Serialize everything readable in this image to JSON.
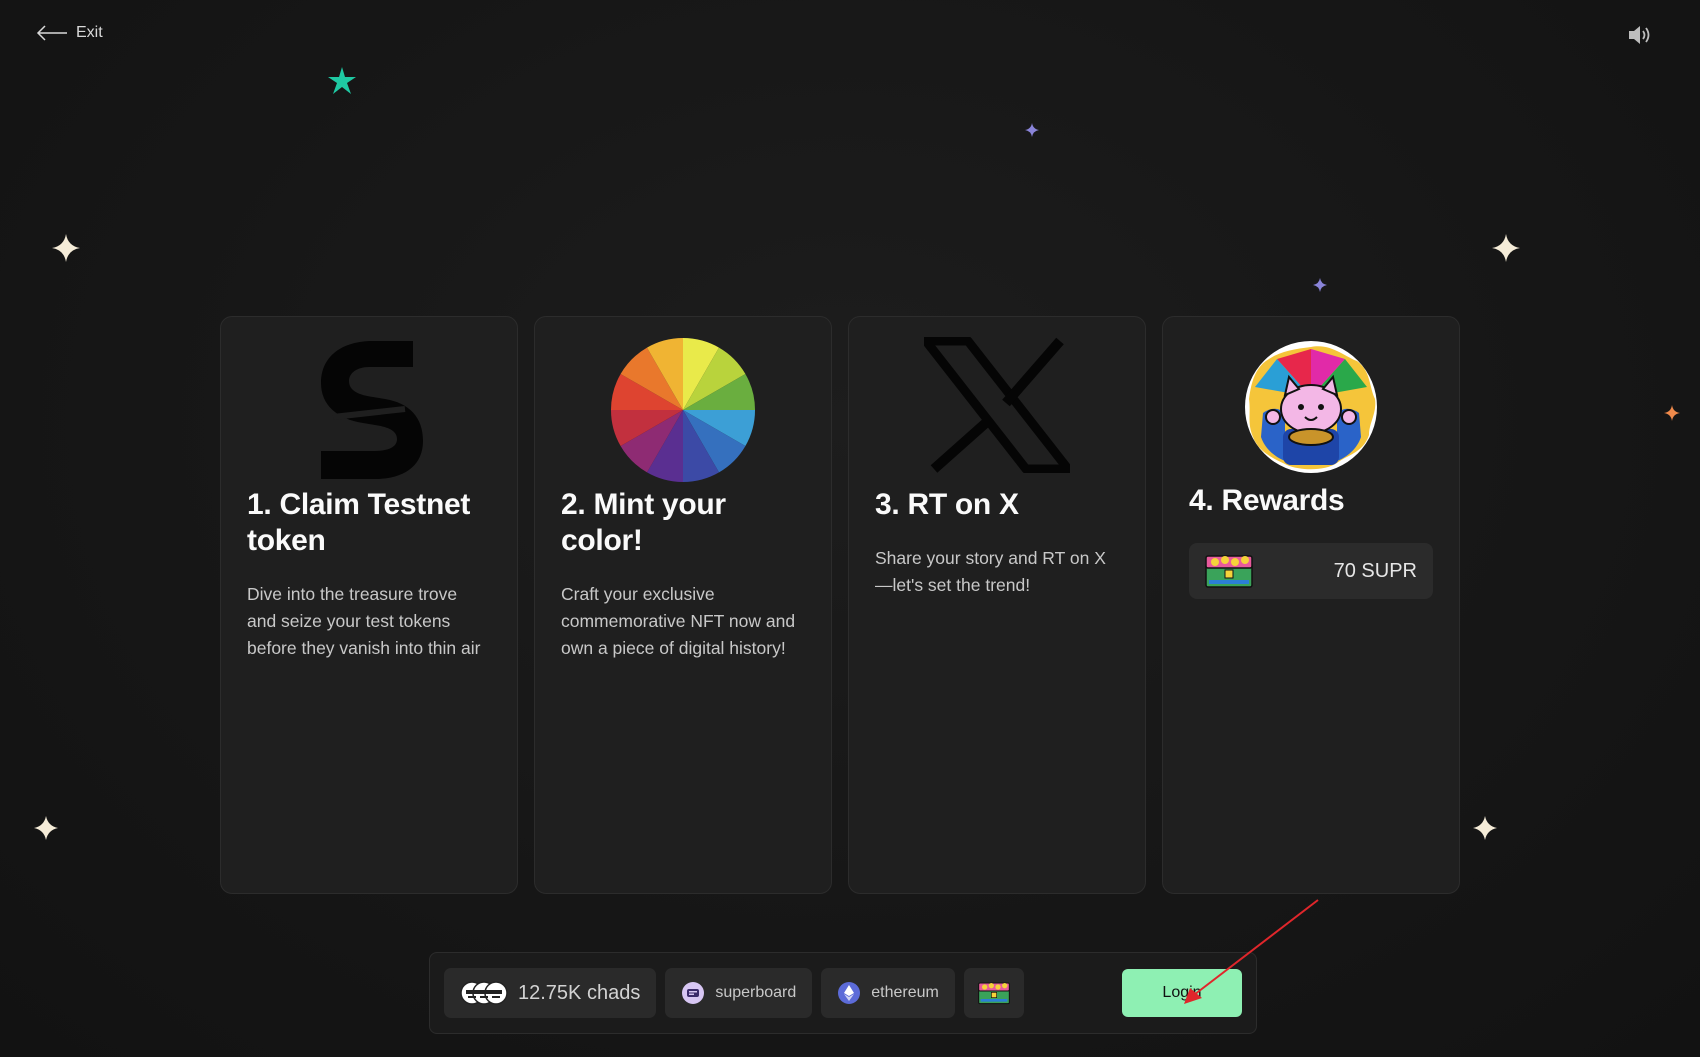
{
  "header": {
    "exit_label": "Exit"
  },
  "cards": [
    {
      "title": "1. Claim Testnet token",
      "description": "Dive into the treasure trove and seize your test tokens before they vanish into thin air",
      "icon": "s-logo-icon"
    },
    {
      "title": "2. Mint your color!",
      "description": "Craft your exclusive commemorative NFT now and own a piece of digital history!",
      "icon": "color-wheel-icon"
    },
    {
      "title": "3. RT on X",
      "description": "Share your story and RT on X—let's set the trend!",
      "icon": "x-logo-icon"
    },
    {
      "title": "4. Rewards",
      "reward_amount": "70 SUPR",
      "icon": "lucky-cat-badge-icon"
    }
  ],
  "footer": {
    "chads_count": "12.75K chads",
    "superboard_label": "superboard",
    "ethereum_label": "ethereum",
    "login_label": "Login"
  },
  "colors": {
    "background": "#151515",
    "card": "#1f1f1f",
    "login_button": "#8ef0b3",
    "accent_teal": "#1fc9a3"
  }
}
